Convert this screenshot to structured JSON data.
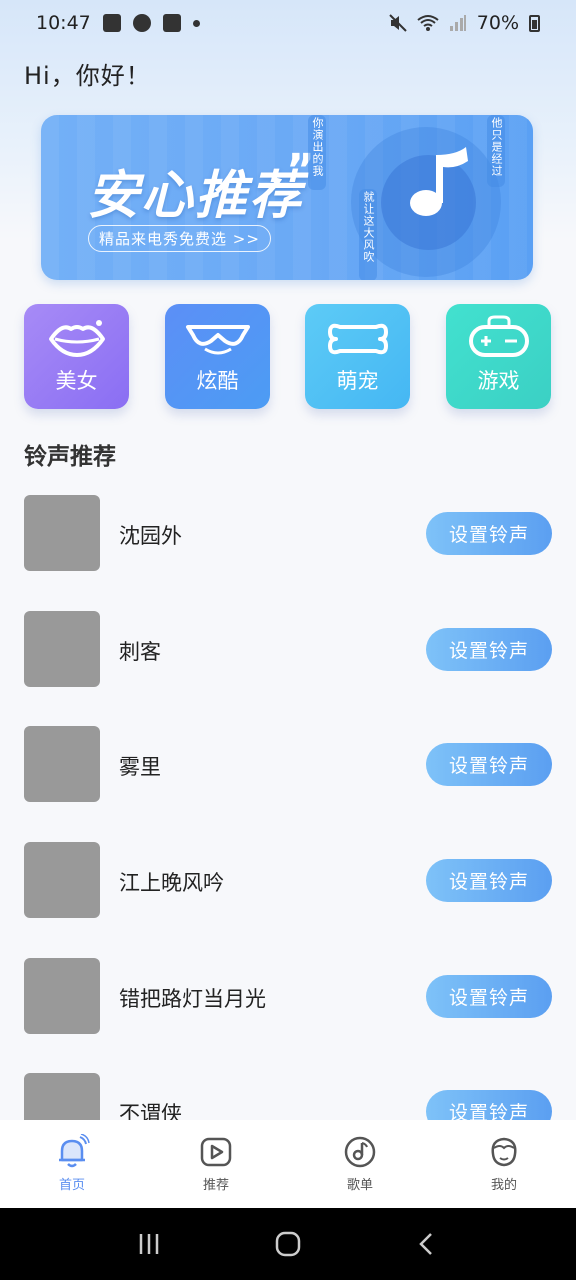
{
  "status_bar": {
    "time": "10:47",
    "battery": "70%"
  },
  "greeting": "Hi，你好！",
  "banner": {
    "title": "安心推荐",
    "quote_mark": "”",
    "subtitle": "精品来电秀免费选 >>",
    "lyrics": [
      "你演出的我",
      "就让这大风吹",
      "他只是经过"
    ]
  },
  "categories": [
    {
      "label": "美女",
      "icon": "lips-icon"
    },
    {
      "label": "炫酷",
      "icon": "sunglasses-icon"
    },
    {
      "label": "萌宠",
      "icon": "bone-icon"
    },
    {
      "label": "游戏",
      "icon": "gamepad-icon"
    }
  ],
  "section_title": "铃声推荐",
  "songs": [
    {
      "title": "沈园外",
      "button": "设置铃声"
    },
    {
      "title": "刺客",
      "button": "设置铃声"
    },
    {
      "title": "雾里",
      "button": "设置铃声"
    },
    {
      "title": "江上晚风吟",
      "button": "设置铃声"
    },
    {
      "title": "错把路灯当月光",
      "button": "设置铃声"
    },
    {
      "title": "不谓侠",
      "button": "设置铃声"
    }
  ],
  "bottom_nav": [
    {
      "label": "首页",
      "icon": "bell-icon",
      "active": true
    },
    {
      "label": "推荐",
      "icon": "play-icon",
      "active": false
    },
    {
      "label": "歌单",
      "icon": "disc-icon",
      "active": false
    },
    {
      "label": "我的",
      "icon": "face-icon",
      "active": false
    }
  ],
  "colors": {
    "accent": "#5a8ef0",
    "button_start": "#7ec2f8",
    "button_end": "#5b9ff1"
  }
}
